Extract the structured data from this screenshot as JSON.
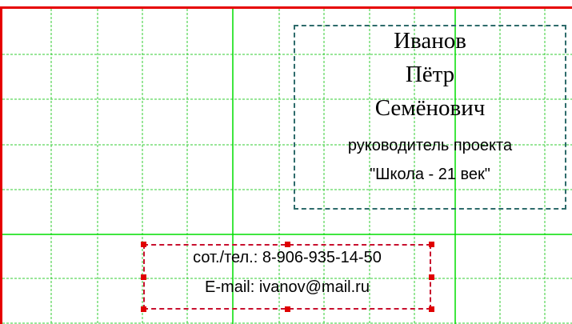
{
  "card": {
    "name_last": "Иванов",
    "name_first": "Пётр",
    "name_middle": "Семёнович",
    "position_line1": "руководитель проекта",
    "position_line2": "\"Школа - 21 век\"",
    "phone": "сот./тел.: 8-906-935-14-50",
    "email": "E-mail: ivanov@mail.ru"
  },
  "colors": {
    "page_border": "#e60000",
    "minor_grid": "#33cc33",
    "major_grid": "#00dd00",
    "text_frame": "#2e6b6b",
    "selection_frame": "#c8102e",
    "handles": "#e00000"
  }
}
